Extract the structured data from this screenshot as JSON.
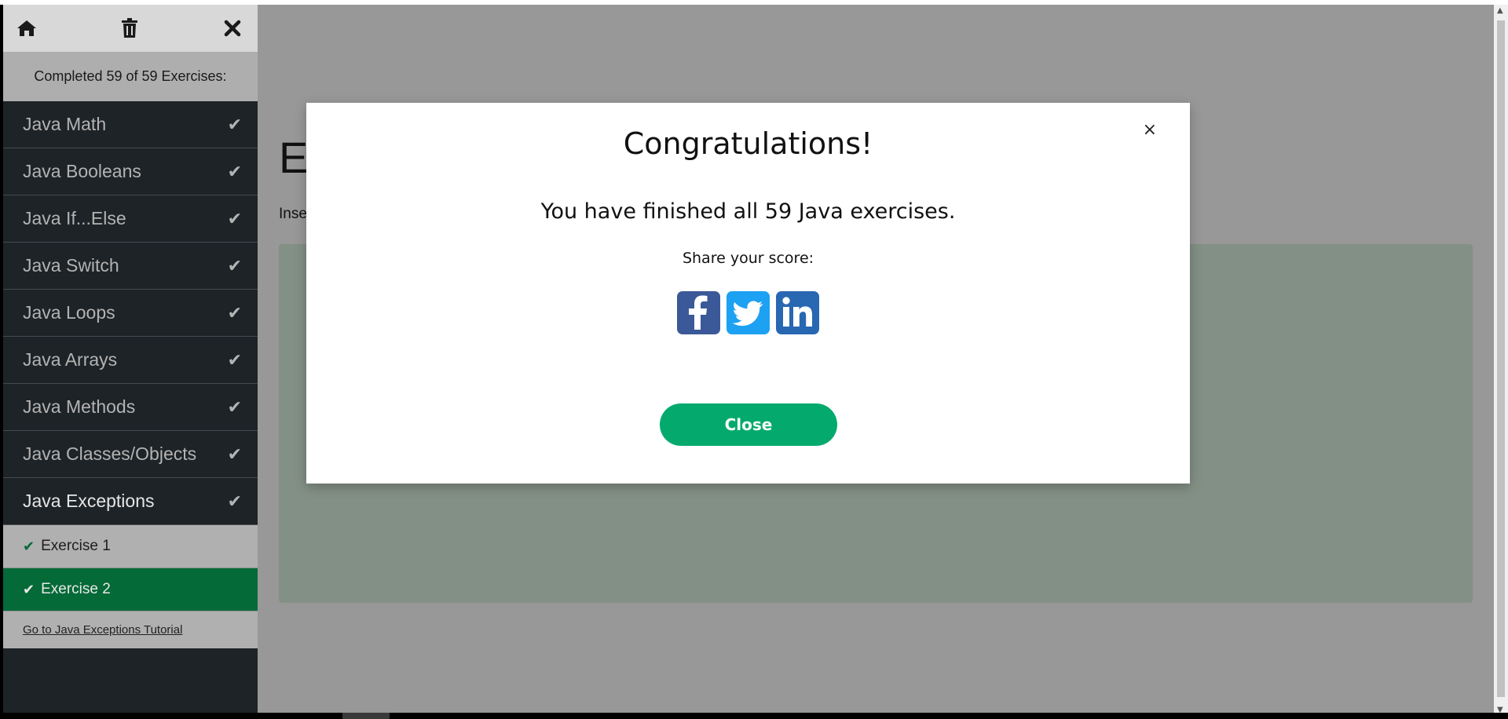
{
  "sidebar": {
    "toolbar": {
      "home_icon": "home-icon",
      "trash_icon": "trash-icon",
      "close_icon": "close-icon"
    },
    "progress": "Completed 59 of 59 Exercises:",
    "chapters": [
      {
        "label": "Java Math",
        "completed": true
      },
      {
        "label": "Java Booleans",
        "completed": true
      },
      {
        "label": "Java If...Else",
        "completed": true
      },
      {
        "label": "Java Switch",
        "completed": true
      },
      {
        "label": "Java Loops",
        "completed": true
      },
      {
        "label": "Java Arrays",
        "completed": true
      },
      {
        "label": "Java Methods",
        "completed": true
      },
      {
        "label": "Java Classes/Objects",
        "completed": true
      },
      {
        "label": "Java Exceptions",
        "completed": true
      }
    ],
    "exercises": [
      {
        "label": "Exercise 1",
        "completed": true
      },
      {
        "label": "Exercise 2",
        "completed": true,
        "current": true
      }
    ],
    "tutorial_link": "Go to Java Exceptions Tutorial"
  },
  "main": {
    "heading": "Ex",
    "instruction": "Inse"
  },
  "modal": {
    "close_symbol": "×",
    "title": "Congratulations!",
    "message": "You have finished all 59 Java exercises.",
    "share_label": "Share your score:",
    "share_icons": [
      "facebook-icon",
      "twitter-icon",
      "linkedin-icon"
    ],
    "close_button": "Close"
  },
  "colors": {
    "accent_green": "#04aa6d",
    "current_exercise_green": "#046a38",
    "facebook": "#3b5998",
    "twitter": "#1da1f2",
    "linkedin": "#2867b2",
    "sidebar_dark": "#1e2327"
  }
}
